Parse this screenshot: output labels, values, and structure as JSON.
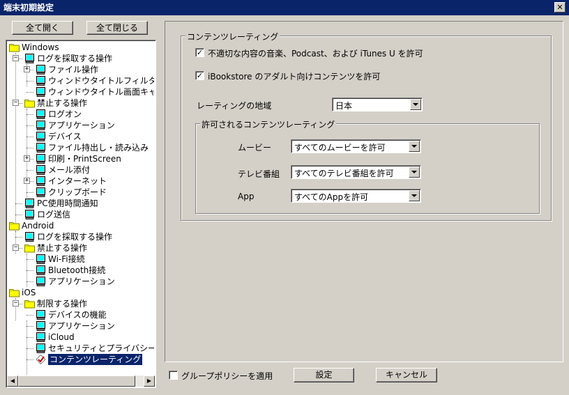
{
  "window": {
    "title": "端末初期設定"
  },
  "toolbar": {
    "expand_all": "全て開く",
    "collapse_all": "全て閉じる"
  },
  "tree": {
    "windows": "Windows",
    "win_log_ops": "ログを採取する操作",
    "win_file_ops": "ファイル操作",
    "win_window_title_filter": "ウィンドウタイトルフィルタ",
    "win_window_title_capture": "ウィンドウタイトル画面キャプチャ",
    "win_prohibited_ops": "禁止する操作",
    "win_logon": "ログオン",
    "win_application": "アプリケーション",
    "win_device": "デバイス",
    "win_file_export": "ファイル持出し・読み込み",
    "win_print": "印刷・PrintScreen",
    "win_mail": "メール添付",
    "win_internet": "インターネット",
    "win_clipboard": "クリップボード",
    "win_pc_usage": "PC使用時間通知",
    "win_log_send": "ログ送信",
    "android": "Android",
    "and_log_ops": "ログを採取する操作",
    "and_prohibited_ops": "禁止する操作",
    "and_wifi": "Wi-Fi接続",
    "and_bluetooth": "Bluetooth接続",
    "and_application": "アプリケーション",
    "ios": "iOS",
    "ios_restricted_ops": "制限する操作",
    "ios_device_func": "デバイスの機能",
    "ios_application": "アプリケーション",
    "ios_icloud": "iCloud",
    "ios_security": "セキュリティとプライバシー",
    "ios_content_rating": "コンテンツレーティング"
  },
  "content_rating": {
    "group_title": "コンテンツレーティング",
    "allow_explicit_label": "不適切な内容の音楽、Podcast、および iTunes U を許可",
    "allow_explicit_checked": "✓",
    "allow_ibookstore_label": "iBookstore のアダルト向けコンテンツを許可",
    "allow_ibookstore_checked": "✓",
    "region_label": "レーティングの地域",
    "region_value": "日本",
    "allowed_group_title": "許可されるコンテンツレーティング",
    "movie_label": "ムービー",
    "movie_value": "すべてのムービーを許可",
    "tv_label": "テレビ番組",
    "tv_value": "すべてのテレビ番組を許可",
    "app_label": "App",
    "app_value": "すべてのAppを許可"
  },
  "footer": {
    "group_policy_label": "グループポリシーを適用",
    "group_policy_checked": "",
    "settings_button": "設定",
    "cancel_button": "キャンセル"
  }
}
